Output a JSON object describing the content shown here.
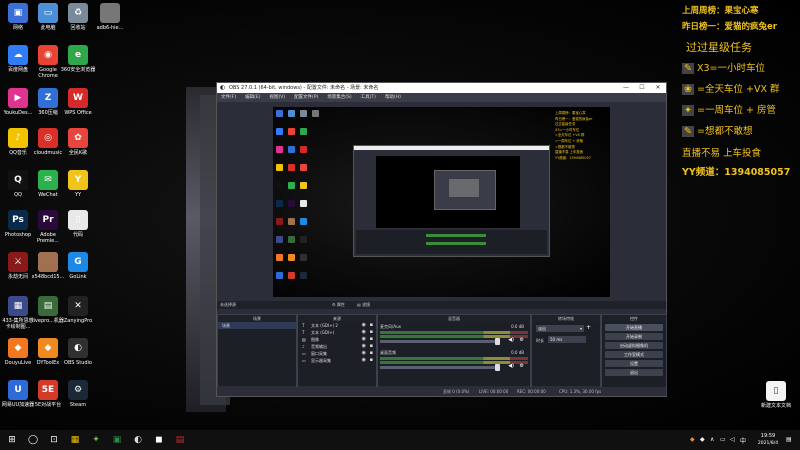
{
  "desktop": {
    "icons": [
      {
        "label": "网络",
        "glyph": "▣",
        "color": "#3a6fd8",
        "col": 0,
        "row": 0
      },
      {
        "label": "此电脑",
        "glyph": "▭",
        "color": "#4d8fd6",
        "col": 1,
        "row": 0
      },
      {
        "label": "回收站",
        "glyph": "♻",
        "color": "#7b8a99",
        "col": 2,
        "row": 0
      },
      {
        "label": "adb6-hie...",
        "glyph": "",
        "color": "#777777",
        "col": 3,
        "row": 0
      },
      {
        "label": "百度网盘",
        "glyph": "☁",
        "color": "#2f7cf6",
        "col": 0,
        "row": 1
      },
      {
        "label": "Google Chrome",
        "glyph": "◉",
        "color": "#e94335",
        "col": 1,
        "row": 1
      },
      {
        "label": "360安全浏览器",
        "glyph": "e",
        "color": "#2ea84a",
        "col": 2,
        "row": 1
      },
      {
        "label": "YoukuDes...",
        "glyph": "▶",
        "color": "#e0338f",
        "col": 0,
        "row": 2
      },
      {
        "label": "360压缩",
        "glyph": "Z",
        "color": "#2f6fd6",
        "col": 1,
        "row": 2
      },
      {
        "label": "WPS Office",
        "glyph": "W",
        "color": "#d42a2a",
        "col": 2,
        "row": 2
      },
      {
        "label": "QQ音乐",
        "glyph": "♪",
        "color": "#f2c300",
        "col": 0,
        "row": 3
      },
      {
        "label": "cloudmusic",
        "glyph": "◎",
        "color": "#d9302a",
        "col": 1,
        "row": 3
      },
      {
        "label": "全民K歌",
        "glyph": "✿",
        "color": "#e8453c",
        "col": 2,
        "row": 3
      },
      {
        "label": "QQ",
        "glyph": "Q",
        "color": "#111111",
        "col": 0,
        "row": 4
      },
      {
        "label": "WeChat",
        "glyph": "✉",
        "color": "#2bb24c",
        "col": 1,
        "row": 4
      },
      {
        "label": "YY",
        "glyph": "Y",
        "color": "#f0c419",
        "col": 2,
        "row": 4
      },
      {
        "label": "Photoshop",
        "glyph": "Ps",
        "color": "#0a2a4a",
        "col": 0,
        "row": 5
      },
      {
        "label": "Adobe Premie...",
        "glyph": "Pr",
        "color": "#2a0a3a",
        "col": 1,
        "row": 5
      },
      {
        "label": "代码",
        "glyph": "▯",
        "color": "#e8e8e8",
        "col": 2,
        "row": 5
      },
      {
        "label": "永劫无间",
        "glyph": "⚔",
        "color": "#8a1a1a",
        "col": 0,
        "row": 6
      },
      {
        "label": "x548bcd15...",
        "glyph": "",
        "color": "#a07050",
        "col": 1,
        "row": 6
      },
      {
        "label": "GoLink",
        "glyph": "G",
        "color": "#1e88e5",
        "col": 2,
        "row": 6
      },
      {
        "label": "433-集所思想卡绘制图...",
        "glyph": "▦",
        "color": "#3a4a8a",
        "col": 0,
        "row": 7
      },
      {
        "label": "livepro...机器",
        "glyph": "▤",
        "color": "#3a6a3a",
        "col": 1,
        "row": 7
      },
      {
        "label": "ZanyingPro",
        "glyph": "✕",
        "color": "#222222",
        "col": 2,
        "row": 7
      },
      {
        "label": "DouyuLive",
        "glyph": "◆",
        "color": "#f07820",
        "col": 0,
        "row": 8
      },
      {
        "label": "DYToolEx",
        "glyph": "◆",
        "color": "#f08a20",
        "col": 1,
        "row": 8
      },
      {
        "label": "OBS Studio",
        "glyph": "◐",
        "color": "#303030",
        "col": 2,
        "row": 8
      },
      {
        "label": "网易UU加速器",
        "glyph": "U",
        "color": "#2e6ad8",
        "col": 0,
        "row": 9
      },
      {
        "label": "5E对战平台",
        "glyph": "5E",
        "color": "#d43a2a",
        "col": 1,
        "row": 9
      },
      {
        "label": "Steam",
        "glyph": "⚙",
        "color": "#1b2838",
        "col": 2,
        "row": 9
      }
    ],
    "right_icon": {
      "label": "新建文本文档",
      "glyph": "▯"
    }
  },
  "overlay": {
    "line1": "上周周榜：果宝心寒",
    "line2": "昨日榜一：爱猫的疯兔er",
    "title": "过过星级任务",
    "tasks": [
      {
        "icon": "✎",
        "text": "X3=一小时车位",
        "color": "#f1c21b"
      },
      {
        "icon": "❀",
        "text": "=全天车位 +VX 群",
        "color": "#f1c21b"
      },
      {
        "icon": "✦",
        "text": "=一周车位 + 房管",
        "color": "#f1c21b"
      },
      {
        "icon": "✎",
        "text": "=想都不敢想",
        "color": "#f1c21b"
      }
    ],
    "slogan": "直播不易 上车投食",
    "channel": "YY频道：1394085057"
  },
  "obs": {
    "title": "OBS 27.0.1 (64-bit, windows) - 配置文件: 未命名 - 场景: 未命名",
    "menu": [
      "文件(F)",
      "编辑(E)",
      "视图(V)",
      "配置文件(P)",
      "场景集合(S)",
      "工具(T)",
      "帮助(H)"
    ],
    "scene_bar": "未选择源",
    "scene_bar_buttons": [
      "⚙ 属性",
      "▤ 滤镜"
    ],
    "docks": {
      "scenes": {
        "title": "场景",
        "items": [
          "场景"
        ]
      },
      "sources": {
        "title": "来源",
        "items": [
          {
            "icon": "T",
            "name": "文本 (GDI+) 2"
          },
          {
            "icon": "T",
            "name": "文本 (GDI+)"
          },
          {
            "icon": "▨",
            "name": "图像"
          },
          {
            "icon": "♪",
            "name": "音频输出"
          },
          {
            "icon": "▭",
            "name": "窗口采集"
          },
          {
            "icon": "▭",
            "name": "显示器采集"
          }
        ]
      },
      "mixer": {
        "title": "混音器",
        "tracks": [
          {
            "name": "麦克风/Aux",
            "db": "0.0 dB"
          },
          {
            "name": "桌面音频",
            "db": "0.0 dB"
          }
        ]
      },
      "transitions": {
        "title": "转场特效",
        "fade": "淡出",
        "duration_label": "时长",
        "duration": "50 ms"
      },
      "controls": {
        "title": "控件",
        "buttons": [
          "开始直播",
          "开始录制",
          "启动虚拟摄像机",
          "工作室模式",
          "设置",
          "退出"
        ]
      }
    },
    "status": {
      "dropped": "丢帧 0 (0.0%)",
      "live": "LIVE: 00:00:00",
      "rec": "REC: 00:00:00",
      "cpu": "CPU: 1.3%, 30.00 fps"
    }
  },
  "taskbar": {
    "icons": [
      "⊞",
      "◯",
      "⊡",
      "▦",
      "✦",
      "▣",
      "◐",
      "◼",
      "▤"
    ],
    "time": "19:59",
    "date": "2021/8/4",
    "lang": "中"
  }
}
